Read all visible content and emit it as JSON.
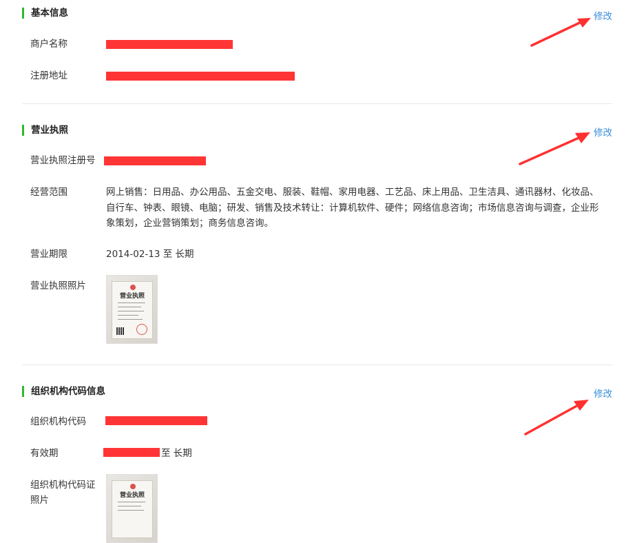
{
  "sections": {
    "basic": {
      "title": "基本信息",
      "edit": "修改",
      "fields": {
        "name_label": "商户名称",
        "address_label": "注册地址"
      }
    },
    "license": {
      "title": "营业执照",
      "edit": "修改",
      "fields": {
        "reg_no_label": "营业执照注册号",
        "scope_label": "经营范围",
        "scope_value": "网上销售：日用品、办公用品、五金交电、服装、鞋帽、家用电器、工艺品、床上用品、卫生洁具、通讯器材、化妆品、自行车、钟表、眼镜、电脑；研发、销售及技术转让：计算机软件、硬件；网络信息咨询；市场信息咨询与调查，企业形象策划，企业营销策划；商务信息咨询。",
        "period_label": "营业期限",
        "period_value": "2014-02-13 至 长期",
        "photo_label": "营业执照照片",
        "photo_title": "营业执照"
      }
    },
    "org": {
      "title": "组织机构代码信息",
      "edit": "修改",
      "fields": {
        "code_label": "组织机构代码",
        "validity_label": "有效期",
        "validity_suffix": "至 长期",
        "photo_label": "组织机构代码证照片",
        "photo_title": "营业执照"
      }
    }
  },
  "colors": {
    "accent_green": "#2eb82e",
    "link_blue": "#3b8fd9",
    "redaction_red": "#ff3535",
    "annotation_arrow": "#ff3030"
  }
}
